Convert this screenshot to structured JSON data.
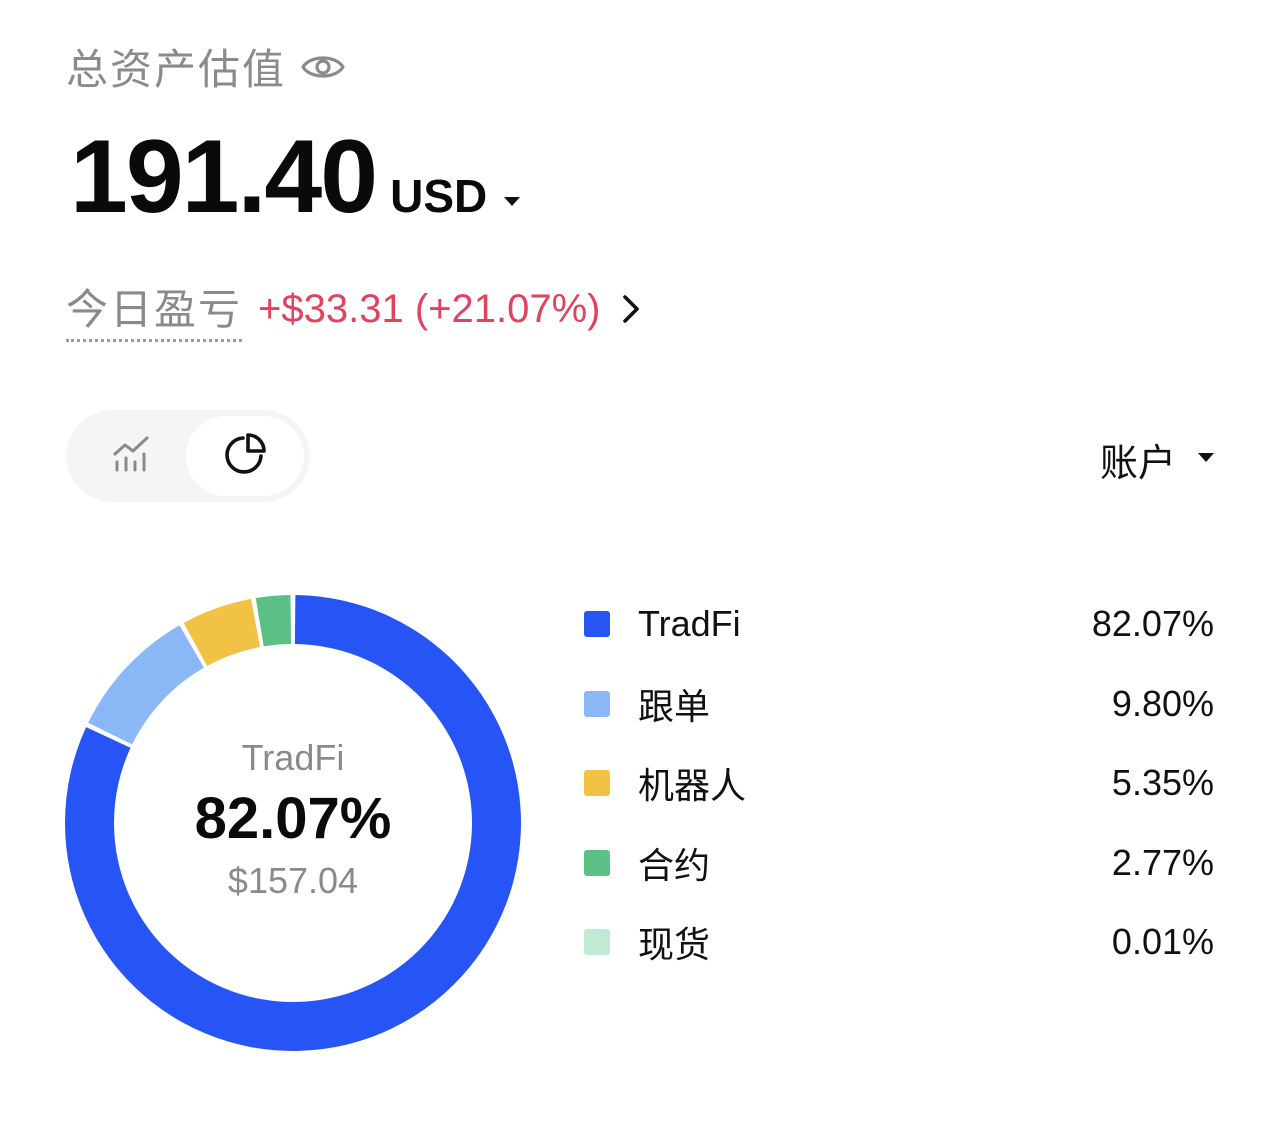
{
  "header": {
    "title": "总资产估值",
    "visibility_icon": "eye-icon"
  },
  "balance": {
    "value": "191.40",
    "currency": "USD",
    "currency_dropdown_icon": "caret-down-icon"
  },
  "pnl": {
    "label": "今日盈亏",
    "value": "+$33.31 (+21.07%)",
    "color": "#e0435d",
    "detail_icon": "chevron-right-icon"
  },
  "view_toggle": {
    "options": [
      {
        "name": "line-chart-view",
        "icon": "line-chart-icon",
        "selected": false
      },
      {
        "name": "pie-chart-view",
        "icon": "pie-chart-icon",
        "selected": true
      }
    ]
  },
  "account_filter": {
    "label": "账户",
    "icon": "caret-down-icon"
  },
  "donut_center": {
    "label": "TradFi",
    "percent": "82.07%",
    "amount": "$157.04"
  },
  "chart_data": {
    "type": "pie",
    "categories": [
      "TradFi",
      "跟单",
      "机器人",
      "合约",
      "现货"
    ],
    "values": [
      82.07,
      9.8,
      5.35,
      2.77,
      0.01
    ],
    "labels": [
      "82.07%",
      "9.80%",
      "5.35%",
      "2.77%",
      "0.01%"
    ],
    "colors": [
      "#2654f5",
      "#8ab8f7",
      "#f2c244",
      "#5cbf86",
      "#bfead3"
    ],
    "legend_position": "right"
  }
}
